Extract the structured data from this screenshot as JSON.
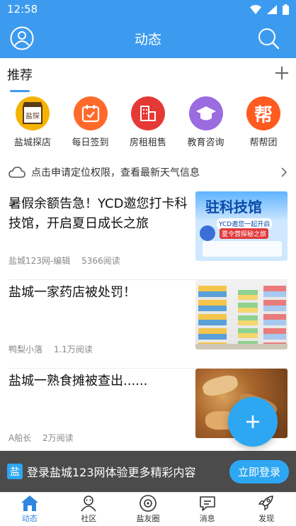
{
  "status": {
    "time": "12:58"
  },
  "header": {
    "title": "动态"
  },
  "tabs": [
    {
      "label": "推荐"
    }
  ],
  "quick_links": [
    {
      "label": "盐城探店",
      "badge": "盐探城店",
      "color": "#f5b300"
    },
    {
      "label": "每日签到",
      "color": "#ff6a2b"
    },
    {
      "label": "房租租售",
      "color": "#e53935"
    },
    {
      "label": "教育咨询",
      "color": "#9b6be0"
    },
    {
      "label": "帮帮团",
      "badge": "帮",
      "color": "#ff5a1f"
    }
  ],
  "weather": {
    "text": "点击申请定位权限，查看最新天气信息"
  },
  "articles": [
    {
      "title": "暑假余额告急！YCD邀您打卡科技馆，开启夏日成长之旅",
      "source": "盐城123网-编辑",
      "reads": "5366阅读",
      "thumb": {
        "headline": "驻科技馆",
        "line1": "YCD邀您一起开启",
        "line2": "夏令营探秘之旅"
      }
    },
    {
      "title": "盐城一家药店被处罚！",
      "source": "鸭梨小落",
      "reads": "1.1万阅读"
    },
    {
      "title": "盐城一熟食摊被查出......",
      "source": "A船长",
      "reads": "2万阅读"
    }
  ],
  "login_bar": {
    "logo": "盐",
    "message": "登录盐城123网体验更多精彩内容",
    "button": "立即登录"
  },
  "bottom_nav": [
    {
      "label": "动态",
      "active": true
    },
    {
      "label": "社区"
    },
    {
      "label": "盐友圈"
    },
    {
      "label": "消息"
    },
    {
      "label": "发现"
    }
  ],
  "colors": {
    "primary": "#3d9bef",
    "accent": "#2ea7f2"
  }
}
